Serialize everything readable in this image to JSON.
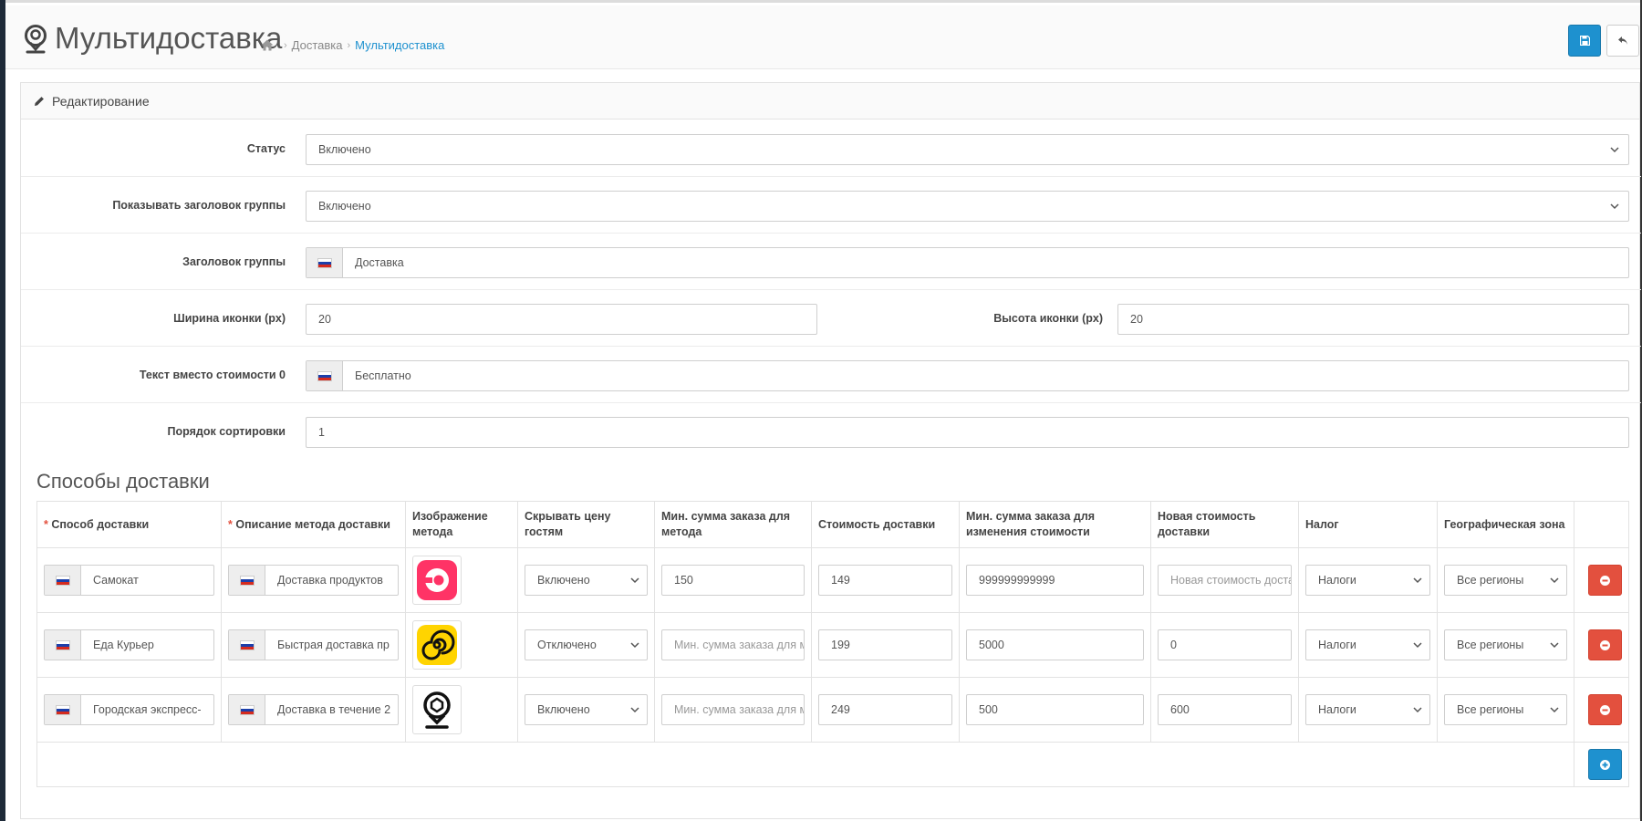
{
  "header": {
    "title": "Мультидоставка",
    "breadcrumb": [
      "Доставка",
      "Мультидоставка"
    ]
  },
  "panel": {
    "heading": "Редактирование"
  },
  "form": {
    "status": {
      "label": "Статус",
      "value": "Включено"
    },
    "show_group_title": {
      "label": "Показывать заголовок группы",
      "value": "Включено"
    },
    "group_title": {
      "label": "Заголовок группы",
      "value": "Доставка"
    },
    "icon_width": {
      "label": "Ширина иконки (px)",
      "value": "20"
    },
    "icon_height": {
      "label": "Высота иконки (px)",
      "value": "20"
    },
    "zero_cost_text": {
      "label": "Текст вместо стоимости 0",
      "value": "Бесплатно"
    },
    "sort_order": {
      "label": "Порядок сортировки",
      "value": "1"
    }
  },
  "methods": {
    "title": "Способы доставки",
    "columns": {
      "method": "Способ доставки",
      "description": "Описание метода доставки",
      "image": "Изображение метода",
      "hide_price": "Скрывать цену гостям",
      "min_sum": "Мин. сумма заказа для метода",
      "cost": "Стоимость доставки",
      "min_sum_change": "Мин. сумма заказа для изменения стоимости",
      "new_cost": "Новая стоимость доставки",
      "tax": "Налог",
      "geo_zone": "Географическая зона"
    },
    "placeholders": {
      "min_sum": "Мин. сумма заказа для метода",
      "new_cost": "Новая стоимость доставки"
    },
    "rows": [
      {
        "name": "Самокат",
        "description": "Доставка продуктов",
        "logo": "samokat-logo",
        "hide_price": "Включено",
        "min_sum": "150",
        "cost": "149",
        "min_sum_change": "999999999999",
        "new_cost": "",
        "tax": "Налоги",
        "geo_zone": "Все регионы"
      },
      {
        "name": "Еда Курьер",
        "description": "Быстрая доставка пр",
        "logo": "eda-logo",
        "hide_price": "Отключено",
        "min_sum": "",
        "cost": "199",
        "min_sum_change": "5000",
        "new_cost": "0",
        "tax": "Налоги",
        "geo_zone": "Все регионы"
      },
      {
        "name": "Городская экспресс-",
        "description": "Доставка в течение 2",
        "logo": "pin-logo",
        "hide_price": "Включено",
        "min_sum": "",
        "cost": "249",
        "min_sum_change": "500",
        "new_cost": "600",
        "tax": "Налоги",
        "geo_zone": "Все регионы"
      }
    ]
  },
  "colors": {
    "primary": "#1e91cf",
    "danger": "#e3503e",
    "samokat": "#ff3366",
    "eda": "#ffd400"
  }
}
